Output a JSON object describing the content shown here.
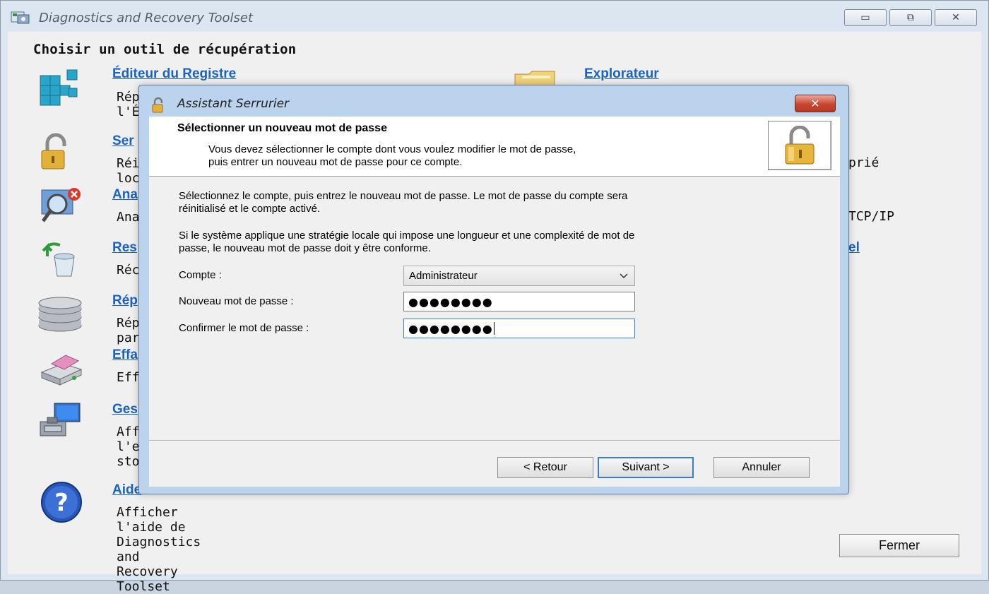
{
  "window": {
    "title": "Diagnostics and Recovery Toolset",
    "min_symbol": "▭",
    "max_symbol": "⧉",
    "close_symbol": "✕"
  },
  "main": {
    "page_title": "Choisir un outil de récupération",
    "tools": [
      {
        "label": "Éditeur du Registre",
        "desc": "Rép\nl'Éd",
        "icon": "registry-cubes-icon"
      },
      {
        "label": "Ser",
        "desc": "Réi\nloca",
        "icon": "padlock-icon"
      },
      {
        "label": "Ana",
        "desc": "Ana",
        "icon": "magnifier-error-icon"
      },
      {
        "label": "Res",
        "desc": "Réc",
        "icon": "recycle-bin-restore-icon"
      },
      {
        "label": "Rép",
        "desc": "Rép\npar",
        "icon": "disk-stack-icon"
      },
      {
        "label": "Effa",
        "desc": "Effa",
        "icon": "disk-eraser-icon"
      },
      {
        "label": "Ges",
        "desc": "Aff\nl'ex\nsto",
        "icon": "computer-management-icon"
      },
      {
        "label": "Aide",
        "desc": "Afficher l'aide de Diagnostics and Recovery\nToolset",
        "icon": "help-icon"
      }
    ],
    "right_tools": [
      {
        "label": "Explorateur",
        "icon": "folder-explorer-icon"
      },
      {
        "label": "",
        "desc": "prié"
      },
      {
        "label": "",
        "desc": "TCP/IP"
      },
      {
        "label": "el",
        "desc": ""
      }
    ],
    "close_button": "Fermer"
  },
  "dialog": {
    "title": "Assistant Serrurier",
    "close_symbol": "✕",
    "header_title": "Sélectionner un nouveau mot de passe",
    "header_line1": "Vous devez sélectionner le compte dont vous voulez modifier le mot de passe,",
    "header_line2": "puis entrer un nouveau mot de passe pour ce compte.",
    "intro_line1": "Sélectionnez le compte, puis entrez le nouveau mot de passe. Le mot de passe du compte sera",
    "intro_line2": "réinitialisé et le compte activé.",
    "policy_line1": "Si le système applique une stratégie locale qui impose une longueur et une complexité de mot de",
    "policy_line2": "passe, le nouveau mot de passe doit y être conforme.",
    "account_label": "Compte :",
    "account_value": "Administrateur",
    "new_password_label": "Nouveau mot de passe :",
    "new_password_value": "●●●●●●●●",
    "confirm_password_label": "Confirmer le mot de passe :",
    "confirm_password_value": "●●●●●●●●",
    "buttons": {
      "back": "< Retour",
      "next": "Suivant >",
      "cancel": "Annuler"
    }
  }
}
